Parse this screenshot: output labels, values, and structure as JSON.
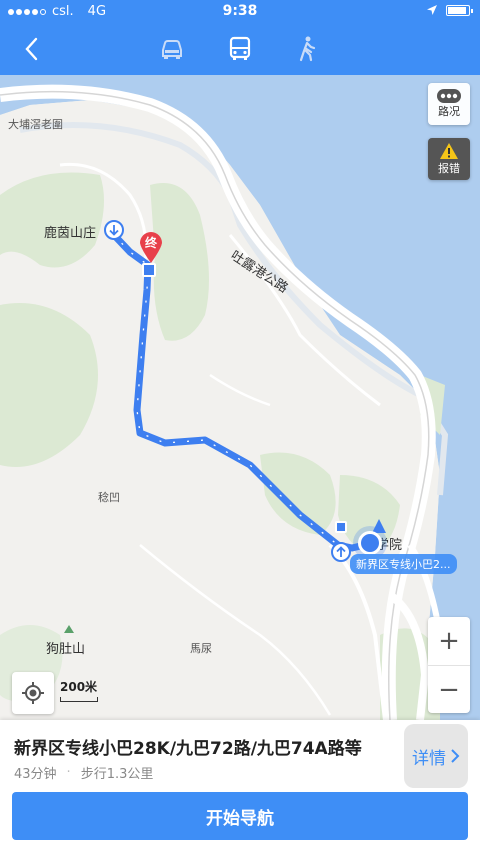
{
  "status_bar": {
    "carrier": "csl.",
    "network": "4G",
    "time": "9:38",
    "signal_bars": 4,
    "battery_level": 0.9
  },
  "header": {
    "icons": {
      "back": "chevron-left-icon",
      "car": "car-icon",
      "bus": "bus-icon",
      "walk": "walk-icon"
    },
    "selected_mode": "bus"
  },
  "map": {
    "labels": {
      "tai_po": "大埔滘老圍",
      "luk_yeung": "鹿茵山庄",
      "tolo_highway": "吐露港公路",
      "wan_au": "稔凹",
      "dog_belly": "狗肚山",
      "ma_liu": "馬尿",
      "college": "学院"
    },
    "end_marker": "终",
    "end_route_label": "新界区专线小巴2...",
    "controls": {
      "traffic": "路况",
      "report": "报错",
      "zoom_in": "+",
      "zoom_out": "−"
    },
    "scale": "200米",
    "colors": {
      "route": "#3e7ff0",
      "water": "#aecdef",
      "green": "#dce9d3",
      "accent": "#3e8ef6"
    }
  },
  "route": {
    "title": "新界区专线小巴28K/九巴72路/九巴74A路等",
    "duration": "43分钟",
    "separator": "·",
    "walk": "步行1.3公里",
    "details_label": "详情",
    "start_button": "开始导航"
  }
}
